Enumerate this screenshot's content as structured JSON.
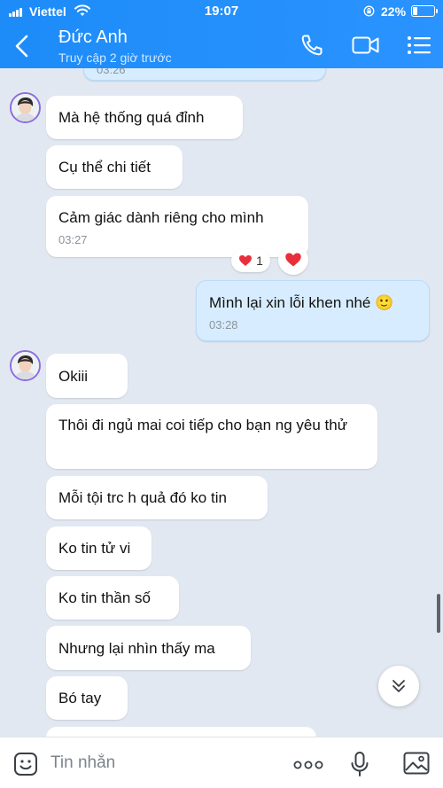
{
  "status_bar": {
    "carrier": "Viettel",
    "time": "19:07",
    "battery_percent": "22%",
    "battery_level": 0.22
  },
  "header": {
    "contact_name": "Đức Anh",
    "last_seen": "Truy cập 2 giờ trước",
    "icons": [
      "back-icon",
      "phone-icon",
      "video-call-icon",
      "menu-icon"
    ]
  },
  "messages": {
    "partial_top_time": "03:26",
    "m1": {
      "text": "Mà hệ thống quá đỉnh"
    },
    "m2": {
      "text": "Cụ thể chi tiết"
    },
    "m3": {
      "text": "Cảm giác dành riêng cho mình",
      "time": "03:27",
      "reaction_count": "1"
    },
    "m4": {
      "text": "Mình lại xin lỗi khen nhé",
      "emoji": "🙂",
      "time": "03:28"
    },
    "m5": {
      "text": "Okiii"
    },
    "m6": {
      "text": "Thôi đi ngủ mai coi tiếp cho bạn ng yêu thử"
    },
    "m7": {
      "text": "Mỗi tội trc h quả đó ko tin"
    },
    "m8": {
      "text": "Ko tin tử vi"
    },
    "m9": {
      "text": "Ko tin thần số"
    },
    "m10": {
      "text": "Nhưng lại nhìn thấy ma"
    },
    "m11": {
      "text": "Bó tay"
    }
  },
  "composer": {
    "placeholder": "Tin nhắn",
    "icons": [
      "sticker-icon",
      "more-icon",
      "microphone-icon",
      "image-icon"
    ]
  },
  "colors": {
    "header": "#1d8cf8",
    "background": "#e2e8f1",
    "my_bubble": "#d7edff",
    "their_bubble": "#ffffff",
    "heart": "#e8303c"
  }
}
